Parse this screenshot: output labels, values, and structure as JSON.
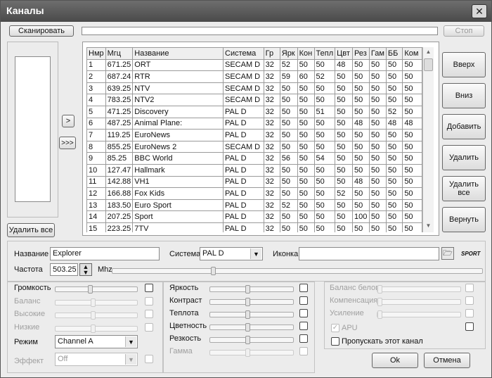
{
  "window": {
    "title": "Каналы",
    "close": "✕"
  },
  "toolbar": {
    "scan": "Сканировать",
    "stop": "Стоп"
  },
  "left": {
    "add_one": ">",
    "add_all": ">>>",
    "delete_all": "Удалить все"
  },
  "table": {
    "headers": [
      "Нмр",
      "Мгц",
      "Название",
      "Система",
      "Гр",
      "Ярк",
      "Кон",
      "Тепл",
      "Цвт",
      "Рез",
      "Гам",
      "ББ",
      "Ком"
    ],
    "rows": [
      [
        "1",
        "671.25",
        "ORT",
        "SECAM D",
        "32",
        "52",
        "50",
        "50",
        "48",
        "50",
        "50",
        "50",
        "50"
      ],
      [
        "2",
        "687.24",
        "RTR",
        "SECAM D",
        "32",
        "59",
        "60",
        "52",
        "50",
        "50",
        "50",
        "50",
        "50"
      ],
      [
        "3",
        "639.25",
        "NTV",
        "SECAM D",
        "32",
        "50",
        "50",
        "50",
        "50",
        "50",
        "50",
        "50",
        "50"
      ],
      [
        "4",
        "783.25",
        "NTV2",
        "SECAM D",
        "32",
        "50",
        "50",
        "50",
        "50",
        "50",
        "50",
        "50",
        "50"
      ],
      [
        "5",
        "471.25",
        "Discovery",
        "PAL D",
        "32",
        "50",
        "50",
        "51",
        "50",
        "50",
        "50",
        "52",
        "50"
      ],
      [
        "6",
        "487.25",
        "Animal Plane:",
        "PAL D",
        "32",
        "50",
        "50",
        "50",
        "50",
        "48",
        "50",
        "48",
        "48"
      ],
      [
        "7",
        "119.25",
        "EuroNews",
        "PAL D",
        "32",
        "50",
        "50",
        "50",
        "50",
        "50",
        "50",
        "50",
        "50"
      ],
      [
        "8",
        "855.25",
        "EuroNews 2",
        "SECAM D",
        "32",
        "50",
        "50",
        "50",
        "50",
        "50",
        "50",
        "50",
        "50"
      ],
      [
        "9",
        "85.25",
        "BBC World",
        "PAL D",
        "32",
        "56",
        "50",
        "54",
        "50",
        "50",
        "50",
        "50",
        "50"
      ],
      [
        "10",
        "127.47",
        "Hallmark",
        "PAL D",
        "32",
        "50",
        "50",
        "50",
        "50",
        "50",
        "50",
        "50",
        "50"
      ],
      [
        "11",
        "142.88",
        "VH1",
        "PAL D",
        "32",
        "50",
        "50",
        "50",
        "50",
        "48",
        "50",
        "50",
        "50"
      ],
      [
        "12",
        "166.88",
        "Fox Kids",
        "PAL D",
        "32",
        "50",
        "50",
        "50",
        "52",
        "50",
        "50",
        "50",
        "50"
      ],
      [
        "13",
        "183.50",
        "Euro Sport",
        "PAL D",
        "32",
        "52",
        "50",
        "50",
        "50",
        "50",
        "50",
        "50",
        "50"
      ],
      [
        "14",
        "207.25",
        "Sport",
        "PAL D",
        "32",
        "50",
        "50",
        "50",
        "50",
        "100",
        "50",
        "50",
        "50"
      ],
      [
        "15",
        "223.25",
        "7TV",
        "PAL D",
        "32",
        "50",
        "50",
        "50",
        "50",
        "50",
        "50",
        "50",
        "50"
      ]
    ]
  },
  "right_buttons": {
    "up": "Вверх",
    "down": "Вниз",
    "add": "Добавить",
    "delete": "Удалить",
    "delete_all": "Удалить все",
    "restore": "Вернуть"
  },
  "details": {
    "name_label": "Название",
    "name_value": "Explorer",
    "system_label": "Система",
    "system_value": "PAL D",
    "icon_label": "Иконка",
    "icon_value": "",
    "icon_brand": "SPORT",
    "freq_label": "Частота",
    "freq_value": "503.25",
    "freq_unit": "Mhz"
  },
  "audio": {
    "volume": "Громкость",
    "balance": "Баланс",
    "treble": "Высокие",
    "bass": "Низкие",
    "mode_label": "Режим",
    "mode_value": "Channel A",
    "effect_label": "Эффект",
    "effect_value": "Off"
  },
  "video": {
    "brightness": "Яркость",
    "contrast": "Контраст",
    "warmth": "Теплота",
    "color": "Цветность",
    "sharpness": "Резкость",
    "gamma": "Гамма"
  },
  "white": {
    "wb": "Баланс белого",
    "comp": "Компенсация",
    "gain": "Усиление",
    "apu": "APU",
    "skip": "Пропускать этот канал"
  },
  "dialog": {
    "ok": "Ok",
    "cancel": "Отмена"
  }
}
